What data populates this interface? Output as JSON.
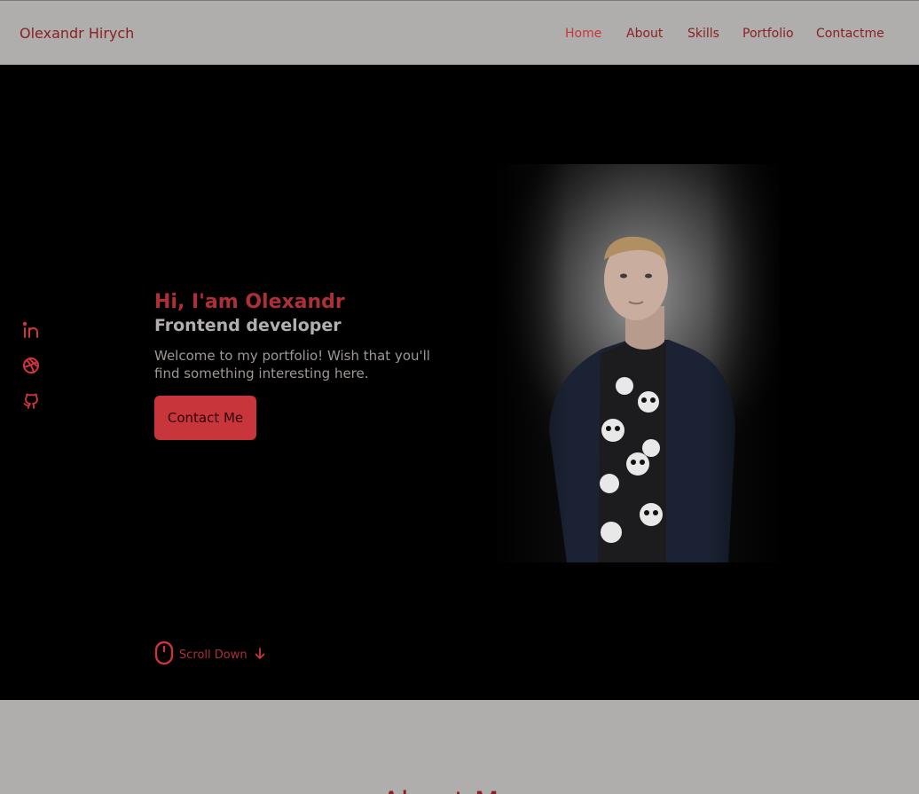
{
  "header": {
    "logo": "Olexandr Hirych",
    "nav": [
      {
        "label": "Home",
        "active": true
      },
      {
        "label": "About",
        "active": false
      },
      {
        "label": "Skills",
        "active": false
      },
      {
        "label": "Portfolio",
        "active": false
      },
      {
        "label": "Contactme",
        "active": false
      }
    ]
  },
  "social": [
    {
      "icon": "linkedin-icon"
    },
    {
      "icon": "dribbble-icon"
    },
    {
      "icon": "github-icon"
    }
  ],
  "hero": {
    "greeting": "Hi, I'am Olexandr",
    "role": "Frontend developer",
    "welcome": "Welcome to my portfolio! Wish that you'll find something interesting here.",
    "cta_label": "Contact Me",
    "scroll_label": "Scroll Down"
  },
  "about": {
    "title": "About Me"
  },
  "colors": {
    "accent": "#c8363b",
    "brand_dark": "#8a1f24",
    "header_bg": "#b0aeac",
    "hero_bg": "#000000"
  }
}
